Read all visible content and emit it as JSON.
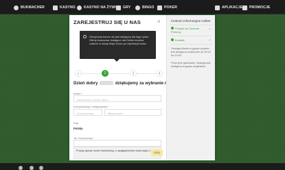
{
  "nav": {
    "left": [
      {
        "label": "BUKMACHER",
        "icon": "ball-icon"
      },
      {
        "label": "KASYNO",
        "icon": "cards-icon"
      },
      {
        "label": "KASYNO NA ŻYWO",
        "icon": "live-icon"
      },
      {
        "label": "GRY",
        "icon": "controller-icon"
      },
      {
        "label": "BINGO",
        "icon": "bingo-icon"
      },
      {
        "label": "POKER",
        "icon": "poker-icon"
      }
    ],
    "right": [
      {
        "label": "APLIKACJE",
        "icon": "phone-icon"
      },
      {
        "label": "PROMOCJE",
        "icon": "gift-icon"
      }
    ]
  },
  "form": {
    "title": "ZAREJESTRUJ SIĘ U NAS",
    "close": "×",
    "tooltip": "Otrzymany bonus nie jest dostępny dla tego rynku. Oferty bonusowe dostępne dla Ciebie możesz znaleźć w sekcji Moje Konto po rejestracji konta.",
    "steps": [
      "✓",
      "2",
      "3",
      "4"
    ],
    "greeting_pre": "Dzień dobry",
    "greeting_post": "dziękujemy za wybranie nas",
    "address_label": "Adres *",
    "address_placeholder": "Nazwa ulicy i numer domu",
    "postcode_label": "Kod pocztowy i miejscowość *",
    "postcode_placeholder": "Kod pocztowy",
    "city_placeholder": "Miejscowość",
    "country_label": "Kraj",
    "country_value": "Polska",
    "phone_label": "Tel. Komórkowy *",
    "hint": "Proszę wpisać numer komórkowy, z uwzględnieniem kodu kraju (+48)",
    "next_button": "Dalej"
  },
  "sidebar": {
    "title": "Centrum Informacyjne Unibet",
    "link1": "Przejdź do Centrum Pomocy",
    "link2": "Kontakt",
    "text1": "Obsługa klienta w języku polskim jest dostępna codziennie od 10:00 do 22:00.",
    "text2": "Poza tymi godzinami, obsługa jest dostępna w języku angielskim."
  },
  "colors": {
    "accent": "#37a337",
    "nav_bg": "#1b1b1b",
    "page_bg": "#2f5a2c"
  }
}
